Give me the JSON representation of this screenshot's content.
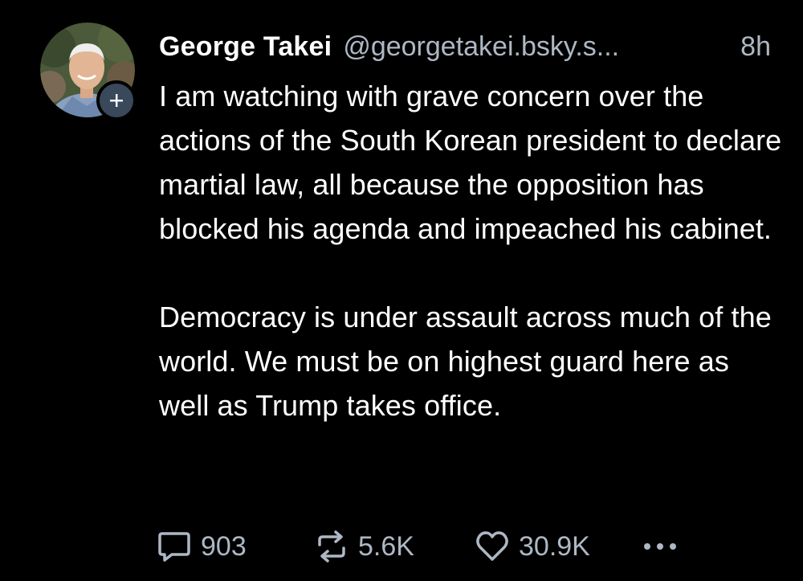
{
  "post": {
    "author": {
      "display_name": "George Takei",
      "handle": "@georgetakei.bsky.s...",
      "follow_icon": "plus-icon"
    },
    "timestamp": "8h",
    "paragraphs": [
      "I am watching with grave concern over the actions of the South Korean president to declare martial law, all because the opposition has blocked his agenda and impeached his cabinet.",
      "Democracy is under assault across much of the world. We must be on highest guard here as well as Trump takes office."
    ],
    "stats": {
      "replies": "903",
      "reposts": "5.6K",
      "likes": "30.9K"
    },
    "icons": {
      "reply": "reply-icon",
      "repost": "repost-icon",
      "like": "heart-icon",
      "more": "more-options-icon"
    },
    "colors": {
      "background": "#000000",
      "text": "#ffffff",
      "muted": "#aeb8c4",
      "follow_button": "#39485a"
    }
  }
}
